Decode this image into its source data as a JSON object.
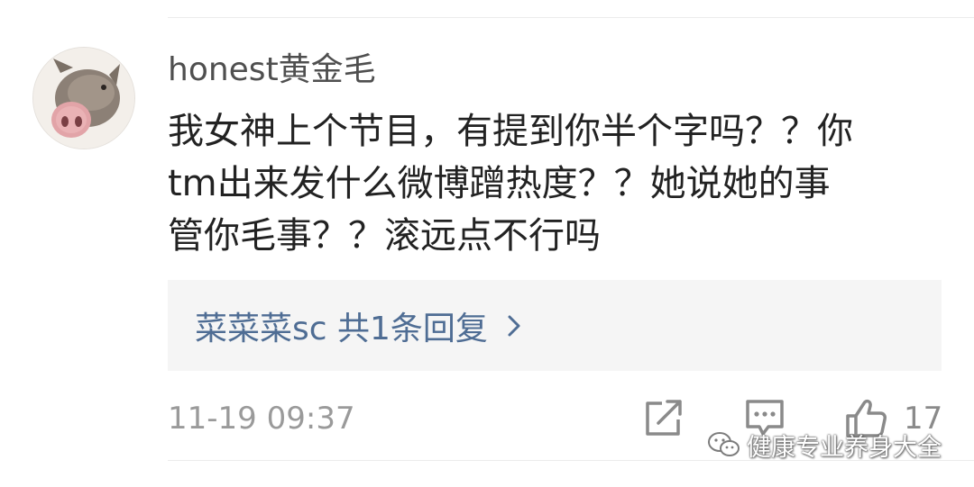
{
  "comment": {
    "username": "honest黄金毛",
    "text_lines": [
      "我女神上个节目，有提到你半个字吗？？你",
      "tm出来发什么微博蹭热度？？她说她的事",
      "管你毛事？？滚远点不行吗"
    ],
    "reply_summary": "菜菜菜sc  共1条回复",
    "timestamp": "11-19 09:37",
    "like_count": "17",
    "icons": {
      "avatar": "pig-avatar",
      "reply_more": "chevron-right-icon",
      "share": "share-icon",
      "comment": "comment-icon",
      "like": "thumbs-up-icon"
    }
  },
  "watermark": {
    "text": "健康专业养身大全",
    "icon": "wechat-icon"
  },
  "colors": {
    "username": "#4f4f4f",
    "body_text": "#222222",
    "reply_link": "#4f6d94",
    "reply_bg": "#f5f5f5",
    "meta": "#9a9a9a"
  }
}
